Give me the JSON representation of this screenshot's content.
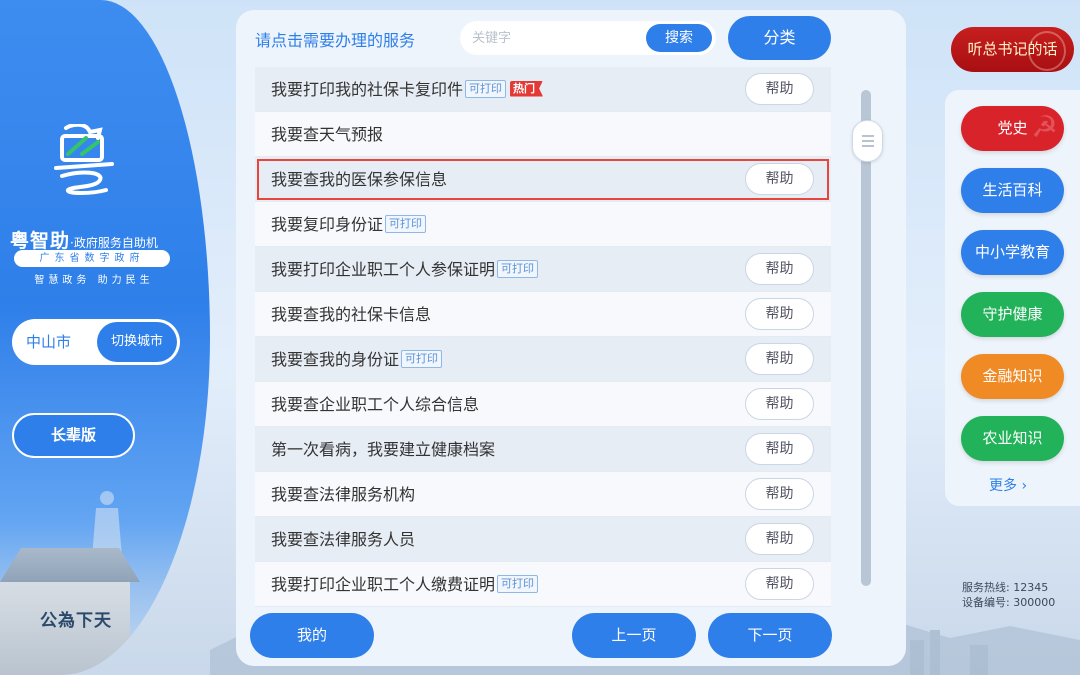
{
  "brand": {
    "title": "粤智助",
    "subtitle": "·政府服务自助机",
    "pill": "广东省数字政府",
    "slogan": "智慧政务 助力民生"
  },
  "city": {
    "name": "中山市",
    "switch_label": "切换城市"
  },
  "elder_mode_label": "长辈版",
  "hall_sign": "公為下天",
  "header": {
    "prompt": "请点击需要办理的服务",
    "search_placeholder": "关键字",
    "search_label": "搜索",
    "category_label": "分类"
  },
  "services": [
    {
      "label": "我要打印我的社保卡复印件",
      "tags": [
        "可打印",
        "热门"
      ],
      "help": "帮助"
    },
    {
      "label": "我要查天气预报",
      "tags": [],
      "help": ""
    },
    {
      "label": "我要查我的医保参保信息",
      "tags": [],
      "help": "帮助",
      "selected": true
    },
    {
      "label": "我要复印身份证",
      "tags": [
        "可打印"
      ],
      "help": ""
    },
    {
      "label": "我要打印企业职工个人参保证明",
      "tags": [
        "可打印"
      ],
      "help": "帮助"
    },
    {
      "label": "我要查我的社保卡信息",
      "tags": [],
      "help": "帮助"
    },
    {
      "label": "我要查我的身份证",
      "tags": [
        "可打印"
      ],
      "help": "帮助"
    },
    {
      "label": "我要查企业职工个人综合信息",
      "tags": [],
      "help": "帮助"
    },
    {
      "label": "第一次看病，我要建立健康档案",
      "tags": [],
      "help": "帮助"
    },
    {
      "label": "我要查法律服务机构",
      "tags": [],
      "help": "帮助"
    },
    {
      "label": "我要查法律服务人员",
      "tags": [],
      "help": "帮助"
    },
    {
      "label": "我要打印企业职工个人缴费证明",
      "tags": [
        "可打印"
      ],
      "help": "帮助"
    }
  ],
  "footer": {
    "mine": "我的",
    "prev": "上一页",
    "next": "下一页"
  },
  "speech_label": "听总书记的话",
  "categories": [
    {
      "label": "党史",
      "color": "#d9232a"
    },
    {
      "label": "生活百科",
      "color": "#2f7fea"
    },
    {
      "label": "中小学教育",
      "color": "#2f7fea"
    },
    {
      "label": "守护健康",
      "color": "#22b35a"
    },
    {
      "label": "金融知识",
      "color": "#f08a24"
    },
    {
      "label": "农业知识",
      "color": "#22b35a"
    }
  ],
  "more_label": "更多 ›",
  "info": {
    "hotline": "服务热线:   12345",
    "device": "设备编号:   300000"
  },
  "colors": {
    "accent": "#2f7fea",
    "hot": "#e53935",
    "party": "#d9232a",
    "selection": "#e8463c"
  }
}
